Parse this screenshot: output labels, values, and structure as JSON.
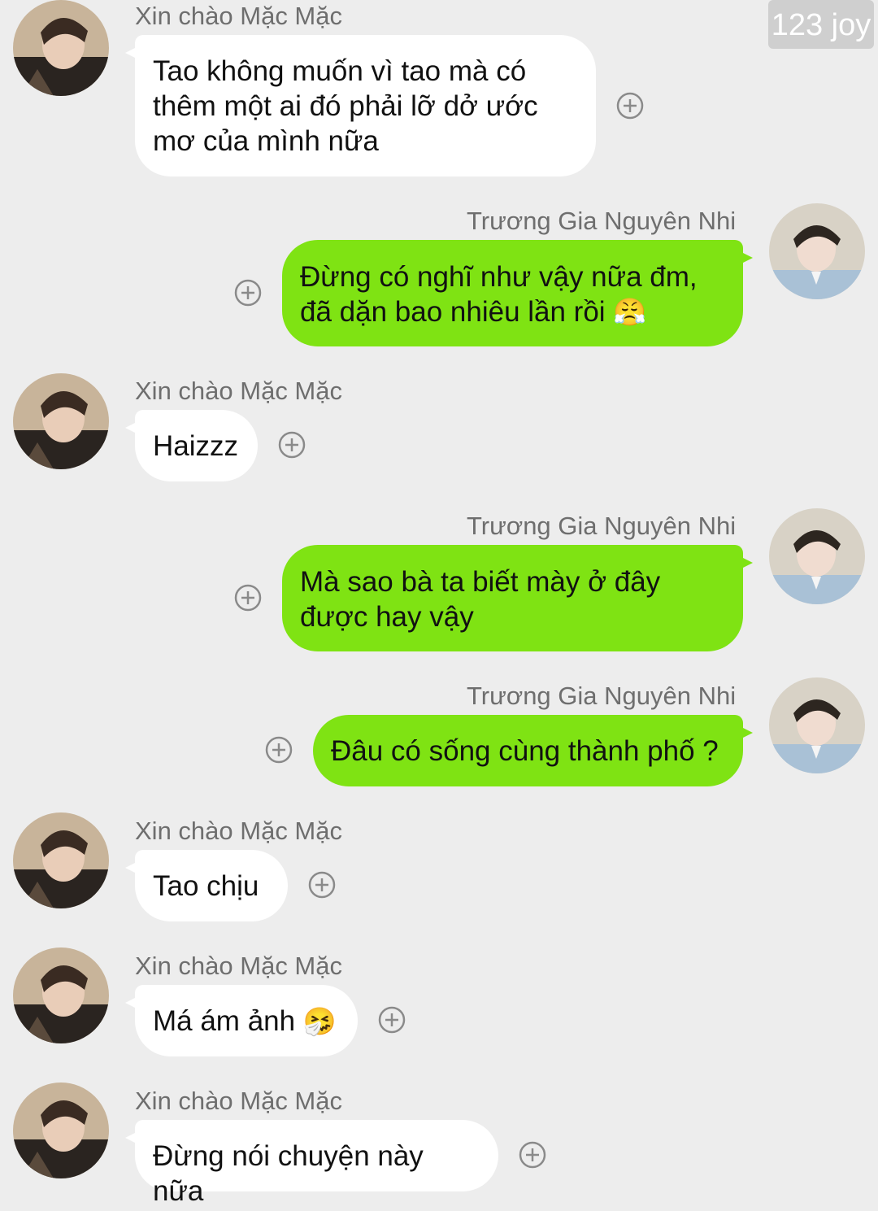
{
  "watermark": "123 joy",
  "senders": {
    "left": "Xin chào Mặc Mặc",
    "right": "Trương Gia Nguyên Nhi"
  },
  "messages": [
    {
      "side": "left",
      "sender": "Xin chào Mặc Mặc",
      "text": "Tao không muốn vì tao mà có thêm một ai đó phải lỡ dở ước mơ của mình nữa"
    },
    {
      "side": "right",
      "sender": "Trương Gia Nguyên Nhi",
      "text": "Đừng có nghĩ như vậy nữa đm, đã dặn bao nhiêu lần rồi",
      "emoji": "😤"
    },
    {
      "side": "left",
      "sender": "Xin chào Mặc Mặc",
      "text": "Haizzz"
    },
    {
      "side": "right",
      "sender": "Trương Gia Nguyên Nhi",
      "text": "Mà sao bà ta biết mày ở đây được hay vậy"
    },
    {
      "side": "right",
      "sender": "Trương Gia Nguyên Nhi",
      "text": "Đâu có sống cùng thành phố ?"
    },
    {
      "side": "left",
      "sender": "Xin chào Mặc Mặc",
      "text": "Tao chịu"
    },
    {
      "side": "left",
      "sender": "Xin chào Mặc Mặc",
      "text": "Má ám ảnh",
      "emoji": "🤧"
    },
    {
      "side": "left",
      "sender": "Xin chào Mặc Mặc",
      "text": "Đừng nói chuyện này nữa"
    }
  ],
  "icons": {
    "add": "plus-circle-icon",
    "avatar_left": "avatar-dark-hair-person",
    "avatar_right": "avatar-light-jacket-person"
  }
}
